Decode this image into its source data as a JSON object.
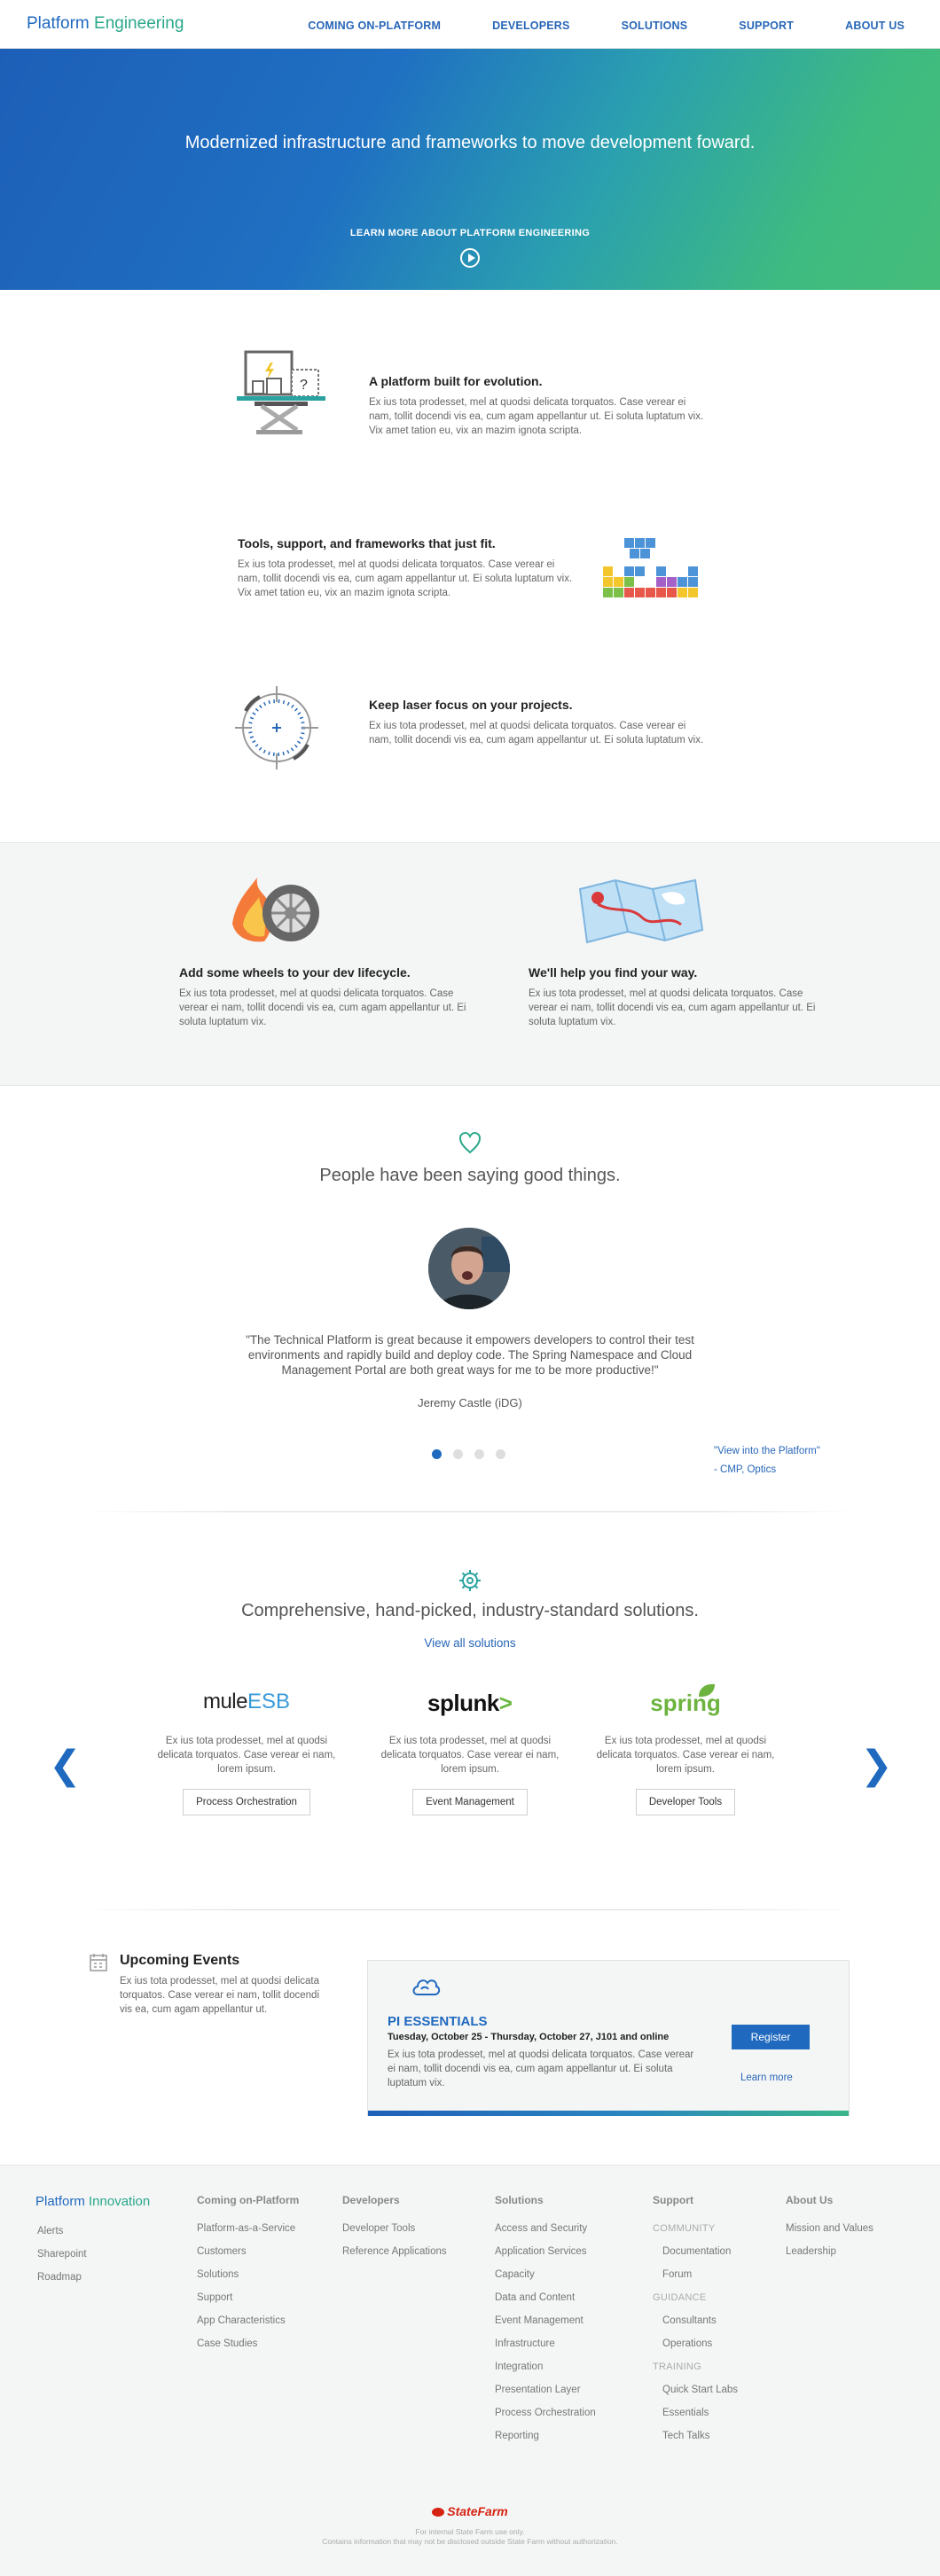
{
  "nav": {
    "brand_a": "Platform ",
    "brand_b": "Engineering",
    "links": [
      "COMING ON-PLATFORM",
      "DEVELOPERS",
      "SOLUTIONS",
      "SUPPORT",
      "ABOUT US"
    ]
  },
  "hero": {
    "headline": "Modernized infrastructure and frameworks to move development foward.",
    "learn": "LEARN MORE ABOUT PLATFORM ENGINEERING"
  },
  "features": [
    {
      "title": "A platform built for evolution.",
      "body": "Ex ius tota prodesset, mel at quodsi delicata torquatos. Case verear ei nam, tollit docendi vis ea, cum agam appellantur ut. Ei soluta luptatum vix. Vix amet tation eu, vix an mazim ignota scripta."
    },
    {
      "title": "Tools, support, and frameworks that just fit.",
      "body": "Ex ius tota prodesset, mel at quodsi delicata torquatos. Case verear ei nam, tollit docendi vis ea, cum agam appellantur ut. Ei soluta luptatum vix. Vix amet tation eu, vix an mazim ignota scripta."
    },
    {
      "title": "Keep laser focus on your projects.",
      "body": "Ex ius tota prodesset, mel at quodsi delicata torquatos. Case verear ei nam, tollit docendi vis ea, cum agam appellantur ut. Ei soluta luptatum vix."
    }
  ],
  "gray": [
    {
      "title": "Add some wheels to your dev lifecycle.",
      "body": "Ex ius tota prodesset, mel at quodsi delicata torquatos. Case verear ei nam, tollit docendi vis ea, cum agam appellantur ut. Ei soluta luptatum vix."
    },
    {
      "title": "We'll help you find your way.",
      "body": "Ex ius tota prodesset, mel at quodsi delicata torquatos. Case verear ei nam, tollit docendi vis ea, cum agam appellantur ut. Ei soluta luptatum vix."
    }
  ],
  "testimonials": {
    "heading": "People have been saying good things.",
    "quote": "\"The Technical Platform is great because it empowers developers to control their test environments and rapidly build and deploy code. The Spring Namespace and Cloud Management Portal are both great ways for me to be more productive!\"",
    "author": "Jeremy Castle (iDG)",
    "side_link_1": "\"View into the Platform\"",
    "side_link_2": "- CMP, Optics",
    "active_slide": 1,
    "slide_count": 4
  },
  "solutions": {
    "heading": "Comprehensive, hand-picked, industry-standard solutions.",
    "view_all": "View all solutions",
    "items": [
      {
        "logo_a": "mule",
        "logo_b": "ESB",
        "body": "Ex ius tota prodesset, mel at quodsi delicata torquatos. Case verear ei nam, lorem ipsum.",
        "button": "Process Orchestration"
      },
      {
        "logo_a": "splunk",
        "logo_b": ">",
        "body": "Ex ius tota prodesset, mel at quodsi delicata torquatos. Case verear ei nam, lorem ipsum.",
        "button": "Event Management"
      },
      {
        "logo_a": "spring",
        "logo_b": "",
        "body": "Ex ius tota prodesset, mel at quodsi delicata torquatos. Case verear ei nam, lorem ipsum.",
        "button": "Developer Tools"
      }
    ]
  },
  "events": {
    "title": "Upcoming Events",
    "body": "Ex ius tota prodesset, mel at quodsi delicata torquatos. Case verear ei nam, tollit docendi vis ea, cum agam appellantur ut.",
    "card_title": "PI ESSENTIALS",
    "card_date": "Tuesday, October 25 - Thursday, October 27, J101 and online",
    "card_body": "Ex ius tota prodesset, mel at quodsi delicata torquatos. Case verear ei nam, tollit docendi vis ea, cum agam appellantur ut. Ei soluta luptatum vix.",
    "register": "Register",
    "learn_more": "Learn more"
  },
  "footer": {
    "brand_a": "Platform ",
    "brand_b": "Innovation",
    "brand_links": [
      "Alerts",
      "Sharepoint",
      "Roadmap"
    ],
    "col_coming": {
      "head": "Coming on-Platform",
      "links": [
        "Platform-as-a-Service",
        "Customers",
        "Solutions",
        "Support",
        "App Characteristics",
        "Case Studies"
      ]
    },
    "col_dev": {
      "head": "Developers",
      "links": [
        "Developer Tools",
        "Reference Applications"
      ]
    },
    "col_sol": {
      "head": "Solutions",
      "links": [
        "Access and Security",
        "Application Services",
        "Capacity",
        "Data and Content",
        "Event Management",
        "Infrastructure",
        "Integration",
        "Presentation Layer",
        "Process Orchestration",
        "Reporting"
      ]
    },
    "col_support": {
      "head": "Support",
      "cat1": "COMMUNITY",
      "cat1_links": [
        "Documentation",
        "Forum"
      ],
      "cat2": "GUIDANCE",
      "cat2_links": [
        "Consultants",
        "Operations"
      ],
      "cat3": "TRAINING",
      "cat3_links": [
        "Quick Start Labs",
        "Essentials",
        "Tech Talks"
      ]
    },
    "col_about": {
      "head": "About Us",
      "links": [
        "Mission and Values",
        "Leadership"
      ]
    },
    "statefarm": "StateFarm",
    "fine1": "For internal State Farm use only.",
    "fine2": "Contains information that may not be disclosed outside State Farm without authorization."
  }
}
